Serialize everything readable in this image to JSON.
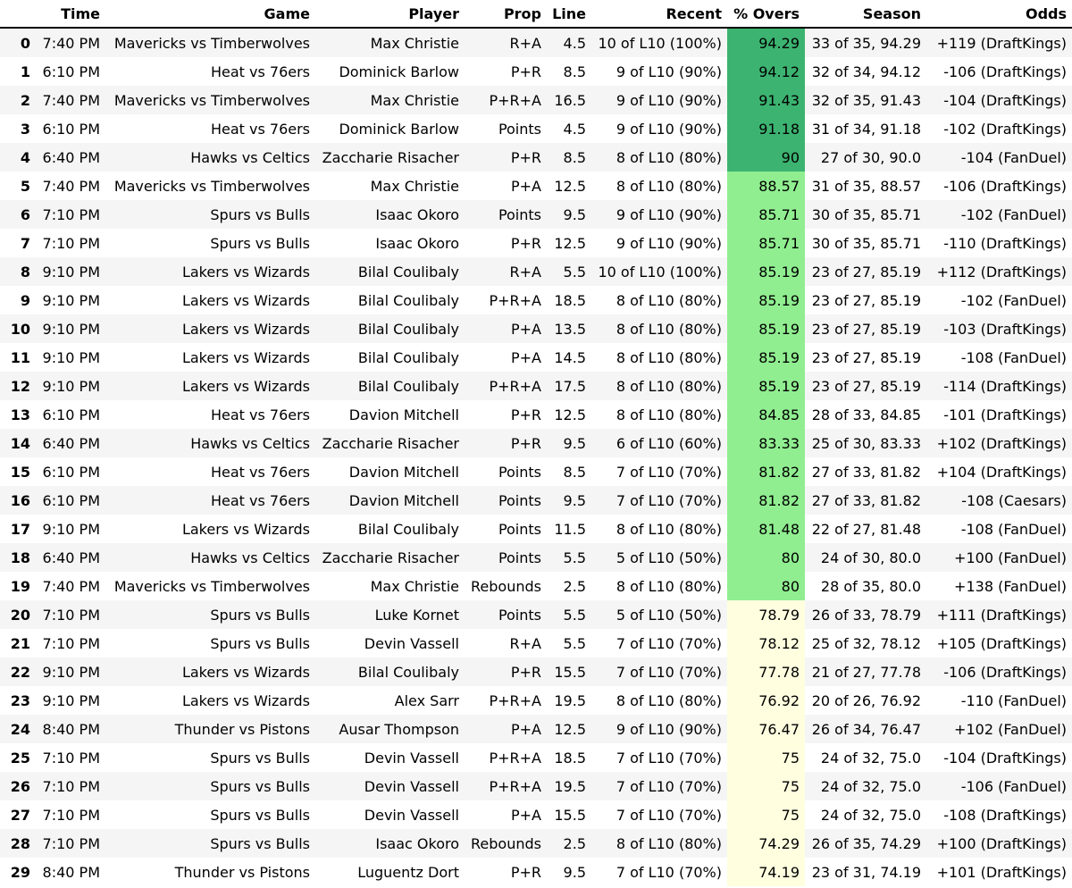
{
  "table": {
    "headers": [
      "",
      "Time",
      "Game",
      "Player",
      "Prop",
      "Line",
      "Recent",
      "% Overs",
      "Season",
      "Odds"
    ],
    "colors": {
      "overs_high": "#3cb371",
      "overs_mid": "#90ee90",
      "overs_low": "#ffffe0",
      "row_stripe": "#f5f5f5"
    },
    "rows": [
      [
        "0",
        "7:40 PM",
        "Mavericks vs Timberwolves",
        "Max Christie",
        "R+A",
        "4.5",
        "10 of L10 (100%)",
        "94.29",
        "33 of 35, 94.29",
        "+119 (DraftKings)"
      ],
      [
        "1",
        "6:10 PM",
        "Heat vs 76ers",
        "Dominick Barlow",
        "P+R",
        "8.5",
        "9 of L10 (90%)",
        "94.12",
        "32 of 34, 94.12",
        "-106 (DraftKings)"
      ],
      [
        "2",
        "7:40 PM",
        "Mavericks vs Timberwolves",
        "Max Christie",
        "P+R+A",
        "16.5",
        "9 of L10 (90%)",
        "91.43",
        "32 of 35, 91.43",
        "-104 (DraftKings)"
      ],
      [
        "3",
        "6:10 PM",
        "Heat vs 76ers",
        "Dominick Barlow",
        "Points",
        "4.5",
        "9 of L10 (90%)",
        "91.18",
        "31 of 34, 91.18",
        "-102 (DraftKings)"
      ],
      [
        "4",
        "6:40 PM",
        "Hawks vs Celtics",
        "Zaccharie Risacher",
        "P+R",
        "8.5",
        "8 of L10 (80%)",
        "90",
        "27 of 30, 90.0",
        "-104 (FanDuel)"
      ],
      [
        "5",
        "7:40 PM",
        "Mavericks vs Timberwolves",
        "Max Christie",
        "P+A",
        "12.5",
        "8 of L10 (80%)",
        "88.57",
        "31 of 35, 88.57",
        "-106 (DraftKings)"
      ],
      [
        "6",
        "7:10 PM",
        "Spurs vs Bulls",
        "Isaac Okoro",
        "Points",
        "9.5",
        "9 of L10 (90%)",
        "85.71",
        "30 of 35, 85.71",
        "-102 (FanDuel)"
      ],
      [
        "7",
        "7:10 PM",
        "Spurs vs Bulls",
        "Isaac Okoro",
        "P+R",
        "12.5",
        "9 of L10 (90%)",
        "85.71",
        "30 of 35, 85.71",
        "-110 (DraftKings)"
      ],
      [
        "8",
        "9:10 PM",
        "Lakers vs Wizards",
        "Bilal Coulibaly",
        "R+A",
        "5.5",
        "10 of L10 (100%)",
        "85.19",
        "23 of 27, 85.19",
        "+112 (DraftKings)"
      ],
      [
        "9",
        "9:10 PM",
        "Lakers vs Wizards",
        "Bilal Coulibaly",
        "P+R+A",
        "18.5",
        "8 of L10 (80%)",
        "85.19",
        "23 of 27, 85.19",
        "-102 (FanDuel)"
      ],
      [
        "10",
        "9:10 PM",
        "Lakers vs Wizards",
        "Bilal Coulibaly",
        "P+A",
        "13.5",
        "8 of L10 (80%)",
        "85.19",
        "23 of 27, 85.19",
        "-103 (DraftKings)"
      ],
      [
        "11",
        "9:10 PM",
        "Lakers vs Wizards",
        "Bilal Coulibaly",
        "P+A",
        "14.5",
        "8 of L10 (80%)",
        "85.19",
        "23 of 27, 85.19",
        "-108 (FanDuel)"
      ],
      [
        "12",
        "9:10 PM",
        "Lakers vs Wizards",
        "Bilal Coulibaly",
        "P+R+A",
        "17.5",
        "8 of L10 (80%)",
        "85.19",
        "23 of 27, 85.19",
        "-114 (DraftKings)"
      ],
      [
        "13",
        "6:10 PM",
        "Heat vs 76ers",
        "Davion Mitchell",
        "P+R",
        "12.5",
        "8 of L10 (80%)",
        "84.85",
        "28 of 33, 84.85",
        "-101 (DraftKings)"
      ],
      [
        "14",
        "6:40 PM",
        "Hawks vs Celtics",
        "Zaccharie Risacher",
        "P+R",
        "9.5",
        "6 of L10 (60%)",
        "83.33",
        "25 of 30, 83.33",
        "+102 (DraftKings)"
      ],
      [
        "15",
        "6:10 PM",
        "Heat vs 76ers",
        "Davion Mitchell",
        "Points",
        "8.5",
        "7 of L10 (70%)",
        "81.82",
        "27 of 33, 81.82",
        "+104 (DraftKings)"
      ],
      [
        "16",
        "6:10 PM",
        "Heat vs 76ers",
        "Davion Mitchell",
        "Points",
        "9.5",
        "7 of L10 (70%)",
        "81.82",
        "27 of 33, 81.82",
        "-108 (Caesars)"
      ],
      [
        "17",
        "9:10 PM",
        "Lakers vs Wizards",
        "Bilal Coulibaly",
        "Points",
        "11.5",
        "8 of L10 (80%)",
        "81.48",
        "22 of 27, 81.48",
        "-108 (FanDuel)"
      ],
      [
        "18",
        "6:40 PM",
        "Hawks vs Celtics",
        "Zaccharie Risacher",
        "Points",
        "5.5",
        "5 of L10 (50%)",
        "80",
        "24 of 30, 80.0",
        "+100 (FanDuel)"
      ],
      [
        "19",
        "7:40 PM",
        "Mavericks vs Timberwolves",
        "Max Christie",
        "Rebounds",
        "2.5",
        "8 of L10 (80%)",
        "80",
        "28 of 35, 80.0",
        "+138 (FanDuel)"
      ],
      [
        "20",
        "7:10 PM",
        "Spurs vs Bulls",
        "Luke Kornet",
        "Points",
        "5.5",
        "5 of L10 (50%)",
        "78.79",
        "26 of 33, 78.79",
        "+111 (DraftKings)"
      ],
      [
        "21",
        "7:10 PM",
        "Spurs vs Bulls",
        "Devin Vassell",
        "R+A",
        "5.5",
        "7 of L10 (70%)",
        "78.12",
        "25 of 32, 78.12",
        "+105 (DraftKings)"
      ],
      [
        "22",
        "9:10 PM",
        "Lakers vs Wizards",
        "Bilal Coulibaly",
        "P+R",
        "15.5",
        "7 of L10 (70%)",
        "77.78",
        "21 of 27, 77.78",
        "-106 (DraftKings)"
      ],
      [
        "23",
        "9:10 PM",
        "Lakers vs Wizards",
        "Alex Sarr",
        "P+R+A",
        "19.5",
        "8 of L10 (80%)",
        "76.92",
        "20 of 26, 76.92",
        "-110 (FanDuel)"
      ],
      [
        "24",
        "8:40 PM",
        "Thunder vs Pistons",
        "Ausar Thompson",
        "P+A",
        "12.5",
        "9 of L10 (90%)",
        "76.47",
        "26 of 34, 76.47",
        "+102 (FanDuel)"
      ],
      [
        "25",
        "7:10 PM",
        "Spurs vs Bulls",
        "Devin Vassell",
        "P+R+A",
        "18.5",
        "7 of L10 (70%)",
        "75",
        "24 of 32, 75.0",
        "-104 (DraftKings)"
      ],
      [
        "26",
        "7:10 PM",
        "Spurs vs Bulls",
        "Devin Vassell",
        "P+R+A",
        "19.5",
        "7 of L10 (70%)",
        "75",
        "24 of 32, 75.0",
        "-106 (FanDuel)"
      ],
      [
        "27",
        "7:10 PM",
        "Spurs vs Bulls",
        "Devin Vassell",
        "P+A",
        "15.5",
        "7 of L10 (70%)",
        "75",
        "24 of 32, 75.0",
        "-108 (DraftKings)"
      ],
      [
        "28",
        "7:10 PM",
        "Spurs vs Bulls",
        "Isaac Okoro",
        "Rebounds",
        "2.5",
        "8 of L10 (80%)",
        "74.29",
        "26 of 35, 74.29",
        "+100 (DraftKings)"
      ],
      [
        "29",
        "8:40 PM",
        "Thunder vs Pistons",
        "Luguentz Dort",
        "P+R",
        "9.5",
        "7 of L10 (70%)",
        "74.19",
        "23 of 31, 74.19",
        "+101 (DraftKings)"
      ]
    ]
  }
}
